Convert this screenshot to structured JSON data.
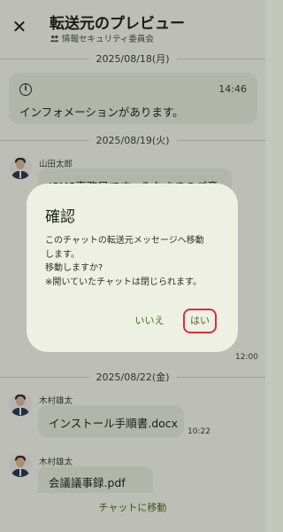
{
  "header": {
    "title": "転送元のプレビュー",
    "subtitle": "情報セキュリティ委員会"
  },
  "dates": {
    "d1": "2025/08/18(月)",
    "d2": "2025/08/19(火)",
    "d3": "2025/08/22(金)"
  },
  "info": {
    "time": "14:46",
    "text": "インフォメーションがあります。"
  },
  "messages": {
    "m1": {
      "sender": "山田太郎",
      "text": "ISMS事務局です。みなさまのご意",
      "time": "12:00"
    },
    "m2": {
      "sender": "木村雄太",
      "text": "インストール手順書.docx",
      "time": "10:22"
    },
    "m3": {
      "sender": "木村雄太",
      "text": "会議議事録.pdf"
    }
  },
  "bottom": {
    "label": "チャットに移動"
  },
  "dialog": {
    "title": "確認",
    "body_lines": [
      "このチャットの転送元メッセージへ移動",
      "します。",
      "移動しますか?",
      "※開いていたチャットは閉じられます。"
    ],
    "no_label": "いいえ",
    "yes_label": "はい"
  },
  "icons": {
    "close": "close-icon",
    "group": "group-icon",
    "info": "info-icon"
  },
  "colors": {
    "accent": "#4f6b1b",
    "highlight": "#e02f2f",
    "bubble": "#e4e8da",
    "dialog": "#eef0e4"
  }
}
